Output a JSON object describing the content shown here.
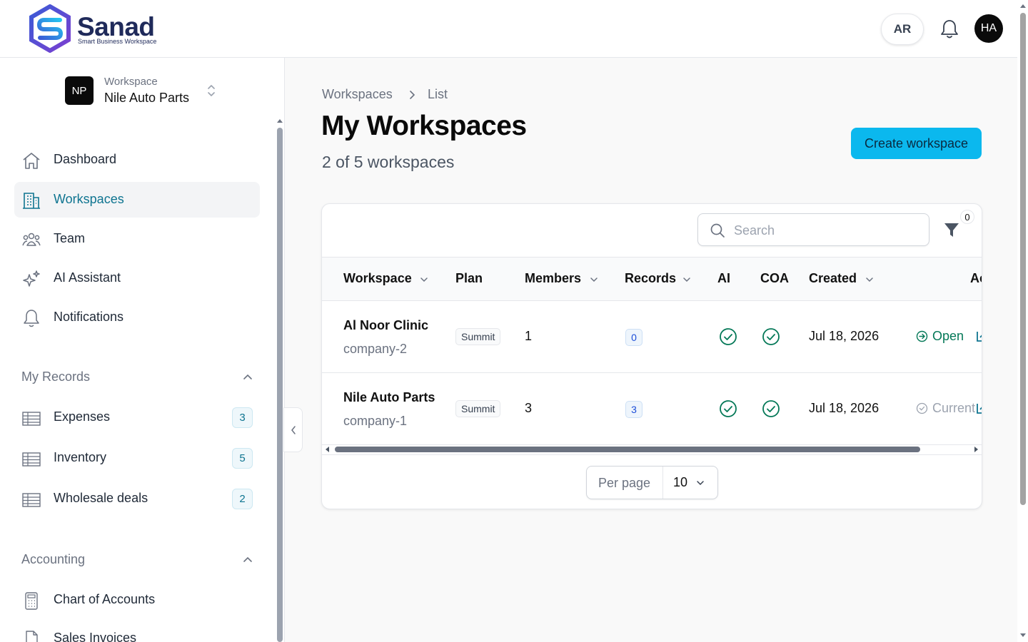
{
  "brand": {
    "name": "Sanad",
    "tagline": "Smart Business Workspace"
  },
  "topbar": {
    "language": "AR",
    "user_initials": "HA"
  },
  "sidebar": {
    "workspace_label": "Workspace",
    "workspace_name": "Nile Auto Parts",
    "workspace_initials": "NP",
    "nav": [
      {
        "label": "Dashboard",
        "icon": "home-icon"
      },
      {
        "label": "Workspaces",
        "icon": "building-icon",
        "active": true
      },
      {
        "label": "Team",
        "icon": "team-icon"
      },
      {
        "label": "AI Assistant",
        "icon": "sparkles-icon"
      },
      {
        "label": "Notifications",
        "icon": "bell-icon"
      }
    ],
    "my_records": {
      "title": "My Records",
      "items": [
        {
          "label": "Expenses",
          "count": "3",
          "icon": "table-icon"
        },
        {
          "label": "Inventory",
          "count": "5",
          "icon": "table-icon"
        },
        {
          "label": "Wholesale deals",
          "count": "2",
          "icon": "table-icon"
        }
      ]
    },
    "accounting": {
      "title": "Accounting",
      "items": [
        {
          "label": "Chart of Accounts",
          "icon": "calculator-icon"
        },
        {
          "label": "Sales Invoices",
          "icon": "document-icon"
        }
      ]
    }
  },
  "main": {
    "breadcrumb": [
      "Workspaces",
      "List"
    ],
    "title": "My Workspaces",
    "subtitle": "2 of 5 workspaces",
    "create_button": "Create workspace",
    "search_placeholder": "Search",
    "filter_count": "0",
    "columns": [
      "Workspace",
      "Plan",
      "Members",
      "Records",
      "AI",
      "COA",
      "Created",
      "Ac"
    ],
    "rows": [
      {
        "name": "Al Noor Clinic",
        "slug": "company-2",
        "plan": "Summit",
        "members": "1",
        "records": "0",
        "ai": true,
        "coa": true,
        "created": "Jul 18, 2026",
        "action": "Open"
      },
      {
        "name": "Nile Auto Parts",
        "slug": "company-1",
        "plan": "Summit",
        "members": "3",
        "records": "3",
        "ai": true,
        "coa": true,
        "created": "Jul 18, 2026",
        "action": "Current"
      }
    ],
    "per_page_label": "Per page",
    "per_page_value": "10"
  },
  "colors": {
    "accent": "#0bb8ee",
    "active_nav": "#0e7490",
    "success": "#047857",
    "brand_navy": "#1f2a5a"
  }
}
